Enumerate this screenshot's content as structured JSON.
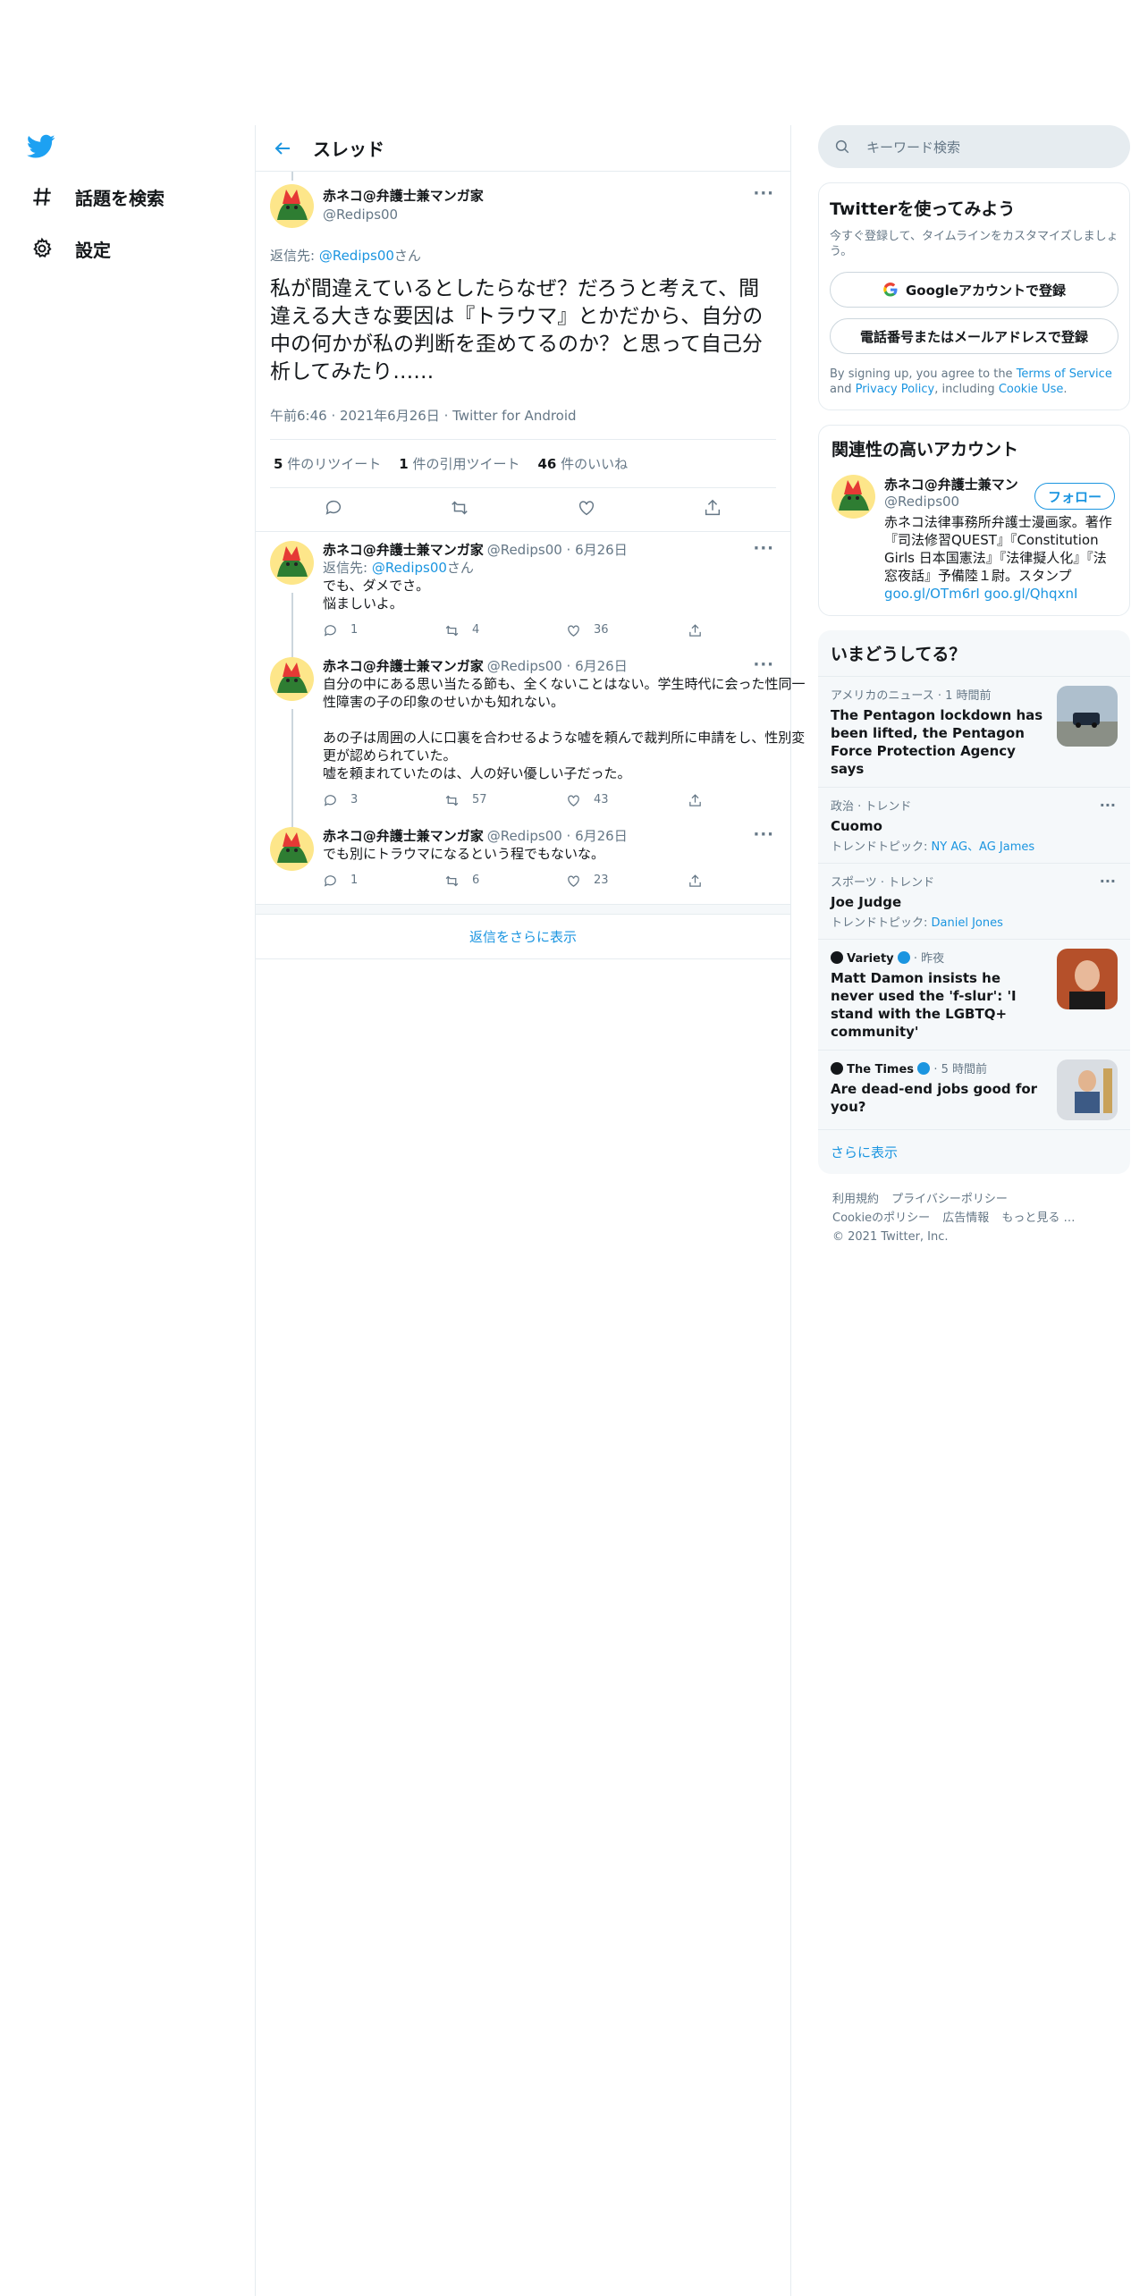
{
  "nav": {
    "items": [
      {
        "label": "話題を検索",
        "icon": "hash-icon"
      },
      {
        "label": "設定",
        "icon": "gear-icon"
      }
    ]
  },
  "header": {
    "title": "スレッド"
  },
  "main_tweet": {
    "author_name": "赤ネコ@弁護士兼マンガ家",
    "author_handle": "@Redips00",
    "reply_prefix": "返信先: ",
    "reply_handle": "@Redips00",
    "reply_suffix": "さん",
    "text": "私が間違えているとしたらなぜ？だろうと考えて、間違える大きな要因は『トラウマ』とかだから、自分の中の何かが私の判断を歪めてるのか？と思って自己分析してみたり……",
    "time": "午前6:46",
    "date": "2021年6月26日",
    "source": "Twitter for Android",
    "retweets": "5",
    "retweets_label": "件のリツイート",
    "quotes": "1",
    "quotes_label": "件の引用ツイート",
    "likes": "46",
    "likes_label": "件のいいね"
  },
  "replies": [
    {
      "name": "赤ネコ@弁護士兼マンガ家",
      "handle": "@Redips00 · 6月26日",
      "reply_prefix": "返信先: ",
      "reply_handle": "@Redips00",
      "reply_suffix": "さん",
      "line1": "でも、ダメでさ。",
      "line2": "悩ましいよ。",
      "replies": "1",
      "retweets": "4",
      "likes": "36"
    },
    {
      "name": "赤ネコ@弁護士兼マンガ家",
      "handle": "@Redips00 · 6月26日",
      "p1": "自分の中にある思い当たる節も、全くないことはない。学生時代に会った性同一性障害の子の印象のせいかも知れない。",
      "p2": "あの子は周囲の人に口裏を合わせるような嘘を頼んで裁判所に申請をし、性別変更が認められていた。",
      "p3": "嘘を頼まれていたのは、人の好い優しい子だった。",
      "replies": "3",
      "retweets": "57",
      "likes": "43"
    },
    {
      "name": "赤ネコ@弁護士兼マンガ家",
      "handle": "@Redips00 · 6月26日",
      "text": "でも別にトラウマになるという程でもないな。",
      "replies": "1",
      "retweets": "6",
      "likes": "23"
    }
  ],
  "show_more_replies": "返信をさらに表示",
  "search": {
    "placeholder": "キーワード検索"
  },
  "signup": {
    "title": "Twitterを使ってみよう",
    "sub": "今すぐ登録して、タイムラインをカスタマイズしましょう。",
    "google_btn": "Googleアカウントで登録",
    "phone_btn": "電話番号またはメールアドレスで登録",
    "tos_1": "By signing up, you agree to the ",
    "tos_link1": "Terms of Service",
    "tos_2": " and ",
    "tos_link2": "Privacy Policy",
    "tos_3": ", including ",
    "tos_link3": "Cookie Use",
    "tos_4": "."
  },
  "related": {
    "title": "関連性の高いアカウント",
    "name": "赤ネコ@弁護士兼マン",
    "handle": "@Redips00",
    "follow": "フォロー",
    "bio": "赤ネコ法律事務所弁護士漫画家。著作『司法修習QUEST』『Constitution Girls 日本国憲法』『法律擬人化』『法窓夜話』予備陸１尉。スタンプ",
    "bio_link1": "goo.gl/OTm6rI",
    "bio_link2": "goo.gl/QhqxnI"
  },
  "trends": {
    "title": "いまどうしてる？",
    "items": [
      {
        "meta": "アメリカのニュース · 1 時間前",
        "headline": "The Pentagon lockdown has been lifted, the Pentagon Force Protection Agency says"
      },
      {
        "meta": "政治 · トレンド",
        "headline": "Cuomo",
        "topic_label": "トレンドトピック: ",
        "topic_links": "NY AG、AG James"
      },
      {
        "meta": "スポーツ · トレンド",
        "headline": "Joe Judge",
        "topic_label": "トレンドトピック: ",
        "topic_links": "Daniel Jones"
      },
      {
        "source": "Variety",
        "meta": "· 昨夜",
        "headline": "Matt Damon insists he never used the 'f-slur': 'I stand with the LGBTQ+ community'"
      },
      {
        "source": "The Times",
        "meta": "· 5 時間前",
        "headline": "Are dead-end jobs good for you?"
      }
    ],
    "show_more": "さらに表示"
  },
  "footer": {
    "links1": [
      "利用規約",
      "プライバシーポリシー"
    ],
    "links2": [
      "Cookieのポリシー",
      "広告情報",
      "もっと見る …"
    ],
    "copyright": "© 2021 Twitter, Inc."
  },
  "colors": {
    "accent": "#1b95e0",
    "muted": "#657786",
    "border": "#e6ecf0"
  }
}
